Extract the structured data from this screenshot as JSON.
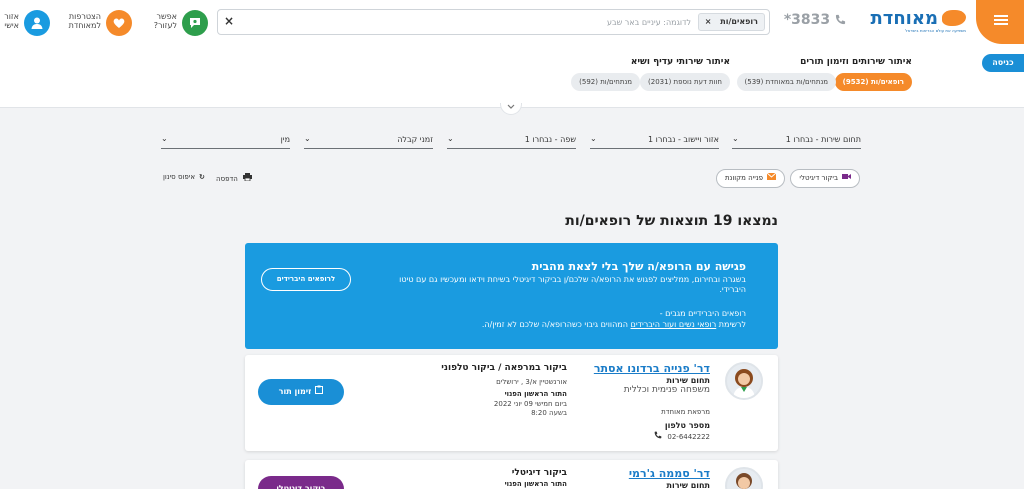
{
  "header": {
    "logo_text": "מאוחדת",
    "logo_sub": "משפיעה את עולם הבריאות בישראל",
    "phone": "3833",
    "phone_star": "*",
    "search": {
      "chip": "רופאים/ות",
      "chip_close": "×",
      "placeholder": "לדוגמה: עיניים באר שבע",
      "clear": "×"
    },
    "actions": [
      {
        "label_line1": "אפשר",
        "label_line2": "לעזור?",
        "color": "#2e9e4c",
        "icon": "chat-icon"
      },
      {
        "label_line1": "הצטרפות",
        "label_line2": "למאוחדת",
        "color": "#f58a2a",
        "icon": "heart-icon"
      },
      {
        "label_line1": "אזור",
        "label_line2": "אישי",
        "color": "#1a9be0",
        "icon": "user-icon"
      }
    ]
  },
  "subheader": {
    "login": "כניסה",
    "services_title": "איתור שירותים וזימון תורים",
    "services_pills": [
      "רופאים/ות (9532)",
      "מנתחים/ות במאוחדת (539)"
    ],
    "extra_title": "איתור שירותי עדיף ושיא",
    "extra_pills": [
      "חוות דעת נוספת (2031)",
      "מנתחים/ות (592)"
    ]
  },
  "filters": {
    "service": "תחום שירות - נבחרו 1",
    "area": "אזור ויישוב - נבחרו 1",
    "language": "שפה - נבחרו 1",
    "hours": "זמני קבלה",
    "gender": "מין",
    "digital_btn": "ביקור דיגיטלי",
    "refer_btn": "פנייה מקוונת",
    "print": "הדפסה",
    "reset": "איפוס סינון"
  },
  "results": {
    "title": "נמצאו 19 תוצאות של רופאים/ות",
    "banner": {
      "title": "פגישה עם הרופא/ה שלך בלי לצאת מהבית",
      "line1": "בשגרה ובחירום, ממליצים לפגוש את הרופא/ה שלכם/ן בביקור דיגיטלי בשיחת וידאו ומעכשיו גם עם טיטו היברידי.",
      "line2": "רופאים היברידיים מגבים -",
      "line3_pre": "לרשימת ",
      "line3_link": "רופאי נשים ועור היברידים",
      "line3_post": " המהווים גיבוי כשהרופא/ה שלכם לא זמין/ה.",
      "button": "לרופאים היברידים"
    },
    "cards": [
      {
        "name": "דר' פנייה ברדונו אסתר",
        "field_label": "תחום שירות",
        "field_value": "משפחה פנימית וכללית",
        "clinic": "מרפאת מאוחדת",
        "phone_label": "מספר טלפון",
        "phone": "02-6442222",
        "visit_type": "ביקור במרפאה / ביקור טלפוני",
        "address": "אורנשטיין א/3 , ירושלים",
        "next_label": "התור הראשון הפנוי",
        "next_date": "ביום חמישי 09 יוני 2022",
        "next_time": "בשעה 8:20",
        "book": "זימון תור",
        "btn_color": "#1a8fd6"
      },
      {
        "name": "דר' סממה ג'רמי",
        "field_label": "תחום שירות",
        "visit_type": "ביקור דיגיטלי",
        "next_label": "התור הראשון הפנוי",
        "book": "ביקור דיגיטלי",
        "btn_color": "#7a2a8a"
      }
    ]
  }
}
